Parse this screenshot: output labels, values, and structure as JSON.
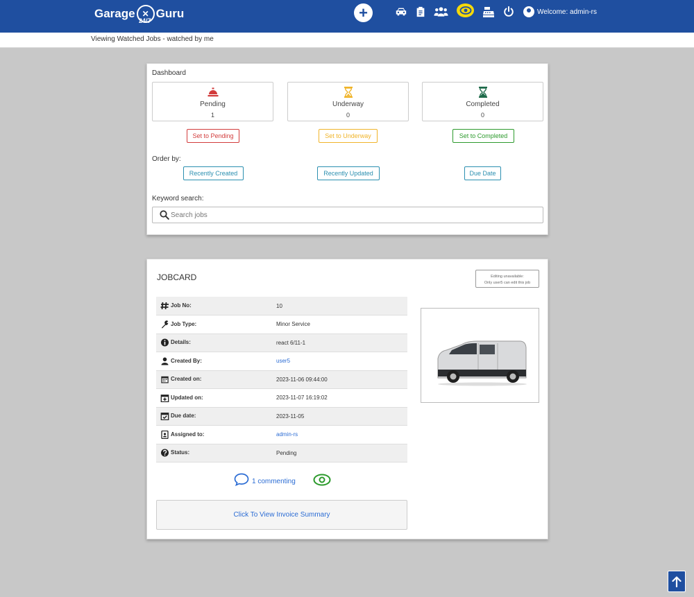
{
  "navbar": {
    "logo_left": "Garage",
    "logo_right": "Guru",
    "logo_sub": "24/7",
    "add_icon": "plus-circle-icon",
    "icons": [
      "car-icon",
      "clipboard-icon",
      "users-icon",
      "eye-icon",
      "cash-register-icon",
      "power-icon"
    ],
    "welcome": "Welcome: admin-rs",
    "brand_color": "#1f4fa0",
    "active_color": "#f5d90a"
  },
  "breadcrumb": "Viewing Watched Jobs - watched by me",
  "dashboard": {
    "title": "Dashboard",
    "stats": [
      {
        "name": "Pending",
        "count": "1",
        "color": "#d23b3b",
        "icon": "bell-icon"
      },
      {
        "name": "Underway",
        "count": "0",
        "color": "#f0b429",
        "icon": "hourglass-icon"
      },
      {
        "name": "Completed",
        "count": "0",
        "color": "#1e6b4a",
        "icon": "hourglass-end-icon"
      }
    ],
    "set_buttons": [
      "Set to Pending",
      "Set to Underway",
      "Set to Completed"
    ],
    "order_label": "Order by:",
    "order_buttons": [
      "Recently Created",
      "Recently Updated",
      "Due Date"
    ],
    "search_label": "Keyword search:",
    "search_placeholder": "Search jobs"
  },
  "jobcard": {
    "title": "JOBCARD",
    "edit_note_line1": "Editing unavailable:",
    "edit_note_line2": "Only user5 can edit this job",
    "rows": [
      {
        "label": "Job No:",
        "value": "10",
        "link": false
      },
      {
        "label": "Job Type:",
        "value": "Minor Service",
        "link": false
      },
      {
        "label": "Details:",
        "value": "react 6/11-1",
        "link": false
      },
      {
        "label": "Created By:",
        "value": "user5",
        "link": true
      },
      {
        "label": "Created on:",
        "value": "2023-11-06 09:44:00",
        "link": false
      },
      {
        "label": "Updated on:",
        "value": "2023-11-07 16:19:02",
        "link": false
      },
      {
        "label": "Due date:",
        "value": "2023-11-05",
        "link": false
      },
      {
        "label": "Assigned to:",
        "value": "admin-rs",
        "link": true
      },
      {
        "label": "Status:",
        "value": "Pending",
        "link": false
      }
    ],
    "comment_text": "1 commenting",
    "invoice_text": "Click To View Invoice Summary"
  }
}
